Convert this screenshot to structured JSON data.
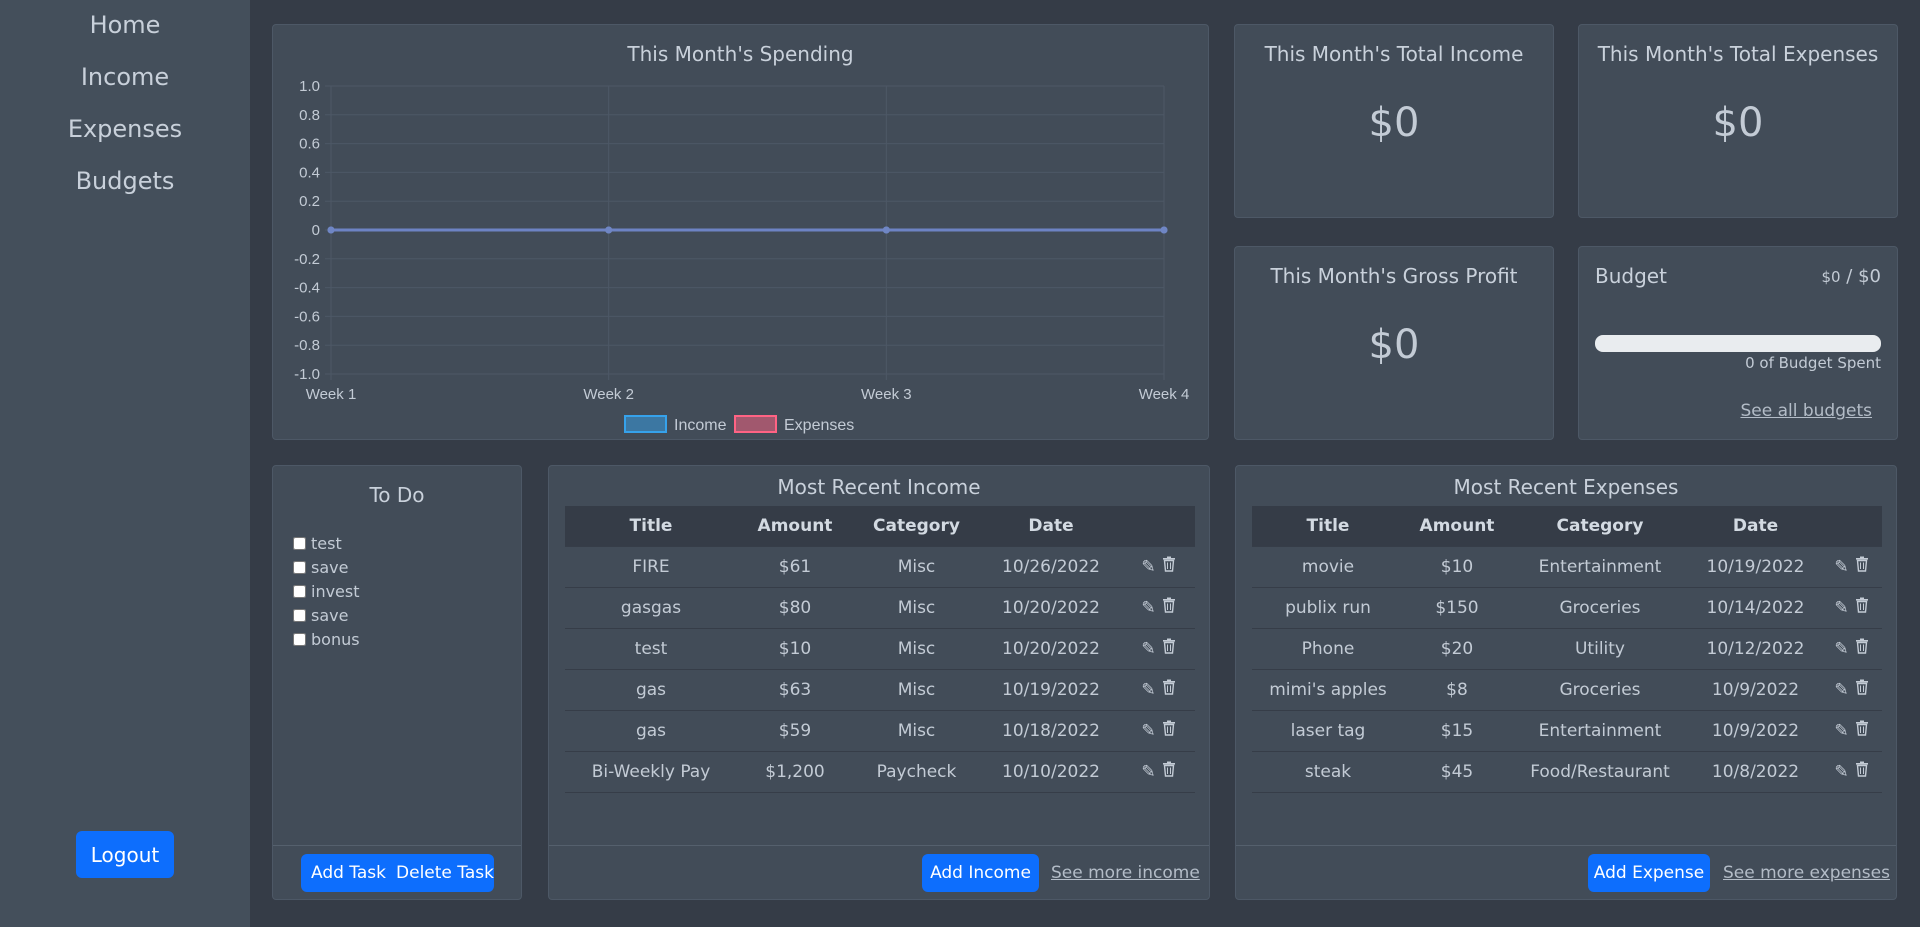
{
  "nav": {
    "items": [
      {
        "label": "Home"
      },
      {
        "label": "Income"
      },
      {
        "label": "Expenses"
      },
      {
        "label": "Budgets"
      }
    ],
    "logout": "Logout"
  },
  "spending": {
    "title": "This Month's Spending"
  },
  "chart_data": {
    "type": "line",
    "title": "This Month's Spending",
    "categories": [
      "Week 1",
      "Week 2",
      "Week 3",
      "Week 4"
    ],
    "y_ticks": [
      "1.0",
      "0.8",
      "0.6",
      "0.4",
      "0.2",
      "0",
      "-0.2",
      "-0.4",
      "-0.6",
      "-0.8",
      "-1.0"
    ],
    "ylim": [
      -1.0,
      1.0
    ],
    "grid": true,
    "legend_position": "bottom",
    "series": [
      {
        "name": "Income",
        "values": [
          0,
          0,
          0,
          0
        ],
        "color": "#36a2eb"
      },
      {
        "name": "Expenses",
        "values": [
          0,
          0,
          0,
          0
        ],
        "color": "#ff6384"
      }
    ]
  },
  "stats": {
    "income": {
      "title": "This Month's Total Income",
      "value": "$0"
    },
    "expenses": {
      "title": "This Month's Total Expenses",
      "value": "$0"
    },
    "profit": {
      "title": "This Month's Gross Profit",
      "value": "$0"
    }
  },
  "budget": {
    "title": "Budget",
    "spent": "$0",
    "separator": "/",
    "total": "$0",
    "progress": 0,
    "caption": "0 of Budget Spent",
    "link": "See all budgets"
  },
  "todo": {
    "title": "To Do",
    "items": [
      "test",
      "save",
      "invest",
      "save",
      "bonus"
    ],
    "add_label": "Add Task",
    "delete_label": "Delete Task"
  },
  "income_table": {
    "title": "Most Recent Income",
    "headers": [
      "Title",
      "Amount",
      "Category",
      "Date"
    ],
    "rows": [
      [
        "FIRE",
        "$61",
        "Misc",
        "10/26/2022"
      ],
      [
        "gasgas",
        "$80",
        "Misc",
        "10/20/2022"
      ],
      [
        "test",
        "$10",
        "Misc",
        "10/20/2022"
      ],
      [
        "gas",
        "$63",
        "Misc",
        "10/19/2022"
      ],
      [
        "gas",
        "$59",
        "Misc",
        "10/18/2022"
      ],
      [
        "Bi-Weekly Pay",
        "$1,200",
        "Paycheck",
        "10/10/2022"
      ]
    ],
    "add_label": "Add Income",
    "more_label": "See more income"
  },
  "expense_table": {
    "title": "Most Recent Expenses",
    "headers": [
      "Title",
      "Amount",
      "Category",
      "Date"
    ],
    "rows": [
      [
        "movie",
        "$10",
        "Entertainment",
        "10/19/2022"
      ],
      [
        "publix run",
        "$150",
        "Groceries",
        "10/14/2022"
      ],
      [
        "Phone",
        "$20",
        "Utility",
        "10/12/2022"
      ],
      [
        "mimi's apples",
        "$8",
        "Groceries",
        "10/9/2022"
      ],
      [
        "laser tag",
        "$15",
        "Entertainment",
        "10/9/2022"
      ],
      [
        "steak",
        "$45",
        "Food/Restaurant",
        "10/8/2022"
      ]
    ],
    "add_label": "Add Expense",
    "more_label": "See more expenses"
  },
  "icons": {
    "edit": "pencil-icon",
    "delete": "trash-icon"
  },
  "colors": {
    "accent": "#0d6efd",
    "background": "#353c47",
    "card": "#424c58",
    "sidebar": "#444f5b"
  }
}
